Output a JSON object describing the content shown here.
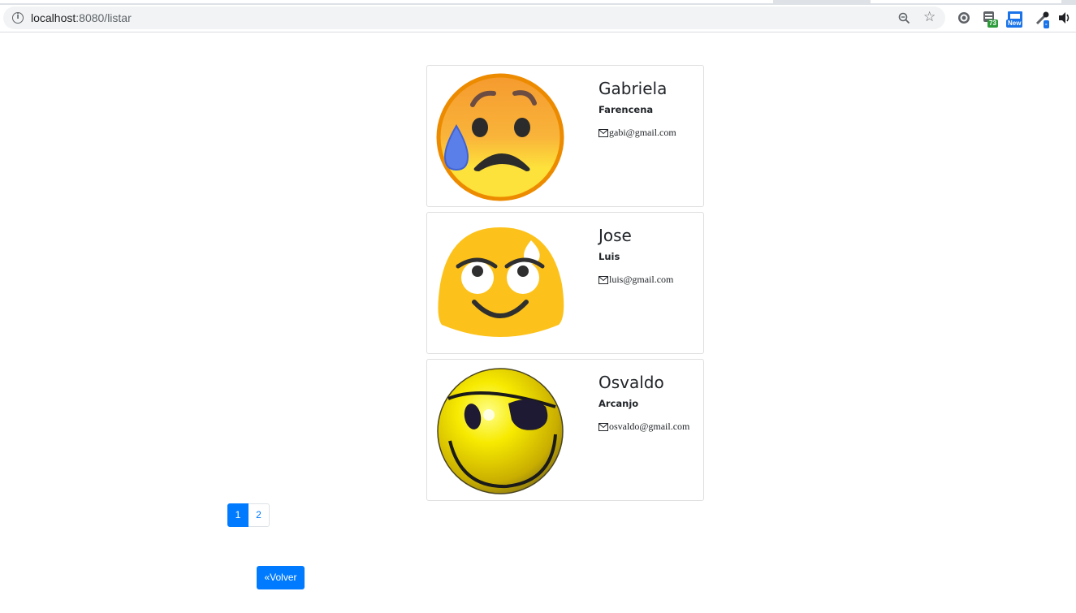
{
  "browser": {
    "url_host": "localhost",
    "url_path": ":8080/listar",
    "extensions": [
      {
        "name": "translate-extension-icon",
        "badge": ""
      },
      {
        "name": "counter-extension-icon",
        "badge": "73"
      },
      {
        "name": "screenshot-extension-icon",
        "badge": "New"
      },
      {
        "name": "eyedropper-extension-icon",
        "badge": "-"
      }
    ]
  },
  "contacts": [
    {
      "first_name": "Gabriela",
      "last_name": "Farencena",
      "email": "gabi@gmail.com",
      "avatar": "sad-sweat-emoji"
    },
    {
      "first_name": "Jose",
      "last_name": "Luis",
      "email": "luis@gmail.com",
      "avatar": "relieved-sweat-emoji"
    },
    {
      "first_name": "Osvaldo",
      "last_name": "Arcanjo",
      "email": "osvaldo@gmail.com",
      "avatar": "pirate-smiley-emoji"
    }
  ],
  "pagination": {
    "pages": [
      "1",
      "2"
    ],
    "current": "1"
  },
  "back_button": {
    "label": "«Volver"
  },
  "colors": {
    "primary": "#007bff",
    "text": "#212529",
    "card_border": "#dfdfdf"
  }
}
